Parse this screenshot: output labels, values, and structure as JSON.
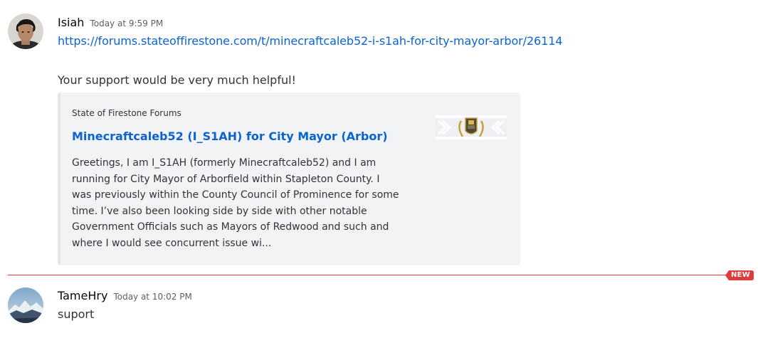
{
  "messages": [
    {
      "author": "Isiah",
      "timestamp": "Today at 9:59 PM",
      "link": "https://forums.stateoffirestone.com/t/minecraftcaleb52-i-s1ah-for-city-mayor-arbor/26114",
      "text": "Your support would be very much helpful!",
      "embed": {
        "provider": "State of Firestone Forums",
        "title": "Minecraftcaleb52 (I_S1AH) for City Mayor (Arbor)",
        "description_lines": [
          "Greetings, I am I_S1AH (formerly Minecraftcaleb52) and I am",
          "running for City Mayor of Arborfield within Stapleton County. I",
          "was previously within the County Council of Prominence for some",
          "time. I’ve also been looking side by side with other notable",
          "Government Officials such as Mayors of Redwood and such and",
          "where I would see concurrent issue wi..."
        ],
        "thumbnail_icon": "crest-laurel-icon"
      }
    },
    {
      "author": "TameHry",
      "timestamp": "Today at 10:02 PM",
      "text": "suport"
    }
  ],
  "divider": {
    "badge": "NEW",
    "color": "#e03b3b"
  },
  "colors": {
    "link": "#0b63d1",
    "embed_bg": "#f2f3f5",
    "text": "#313338"
  }
}
